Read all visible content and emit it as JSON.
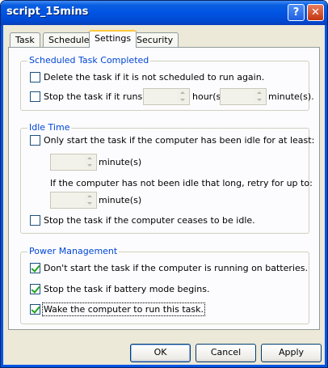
{
  "window": {
    "title": "script_15mins",
    "help_label": "?",
    "close_label": "✕"
  },
  "tabs": [
    "Task",
    "Schedule",
    "Settings",
    "Security"
  ],
  "scheduled": {
    "legend": "Scheduled Task Completed",
    "delete_label": "Delete the task if it is not scheduled to run again.",
    "stop_label": "Stop the task if it runs for:",
    "hours_unit": "hour(s)",
    "minutes_unit": "minute(s)."
  },
  "idle": {
    "legend": "Idle Time",
    "only_start_label": "Only start the task if the computer has been idle for at least:",
    "minutes_unit": "minute(s)",
    "retry_text": "If the computer has not been idle that long, retry for up to:",
    "retry_unit": "minute(s)",
    "stop_idle_label": "Stop the task if the computer ceases to be idle."
  },
  "power": {
    "legend": "Power Management",
    "no_batt_label": "Don't start the task if the computer is running on batteries.",
    "stop_batt_label": "Stop the task if battery mode begins.",
    "wake_label": "Wake the computer to run this task."
  },
  "buttons": {
    "ok": "OK",
    "cancel": "Cancel",
    "apply": "Apply"
  },
  "state": {
    "delete_checked": false,
    "stop_checked": false,
    "only_start_checked": false,
    "stop_idle_checked": false,
    "no_batt_checked": true,
    "stop_batt_checked": true,
    "wake_checked": true
  }
}
